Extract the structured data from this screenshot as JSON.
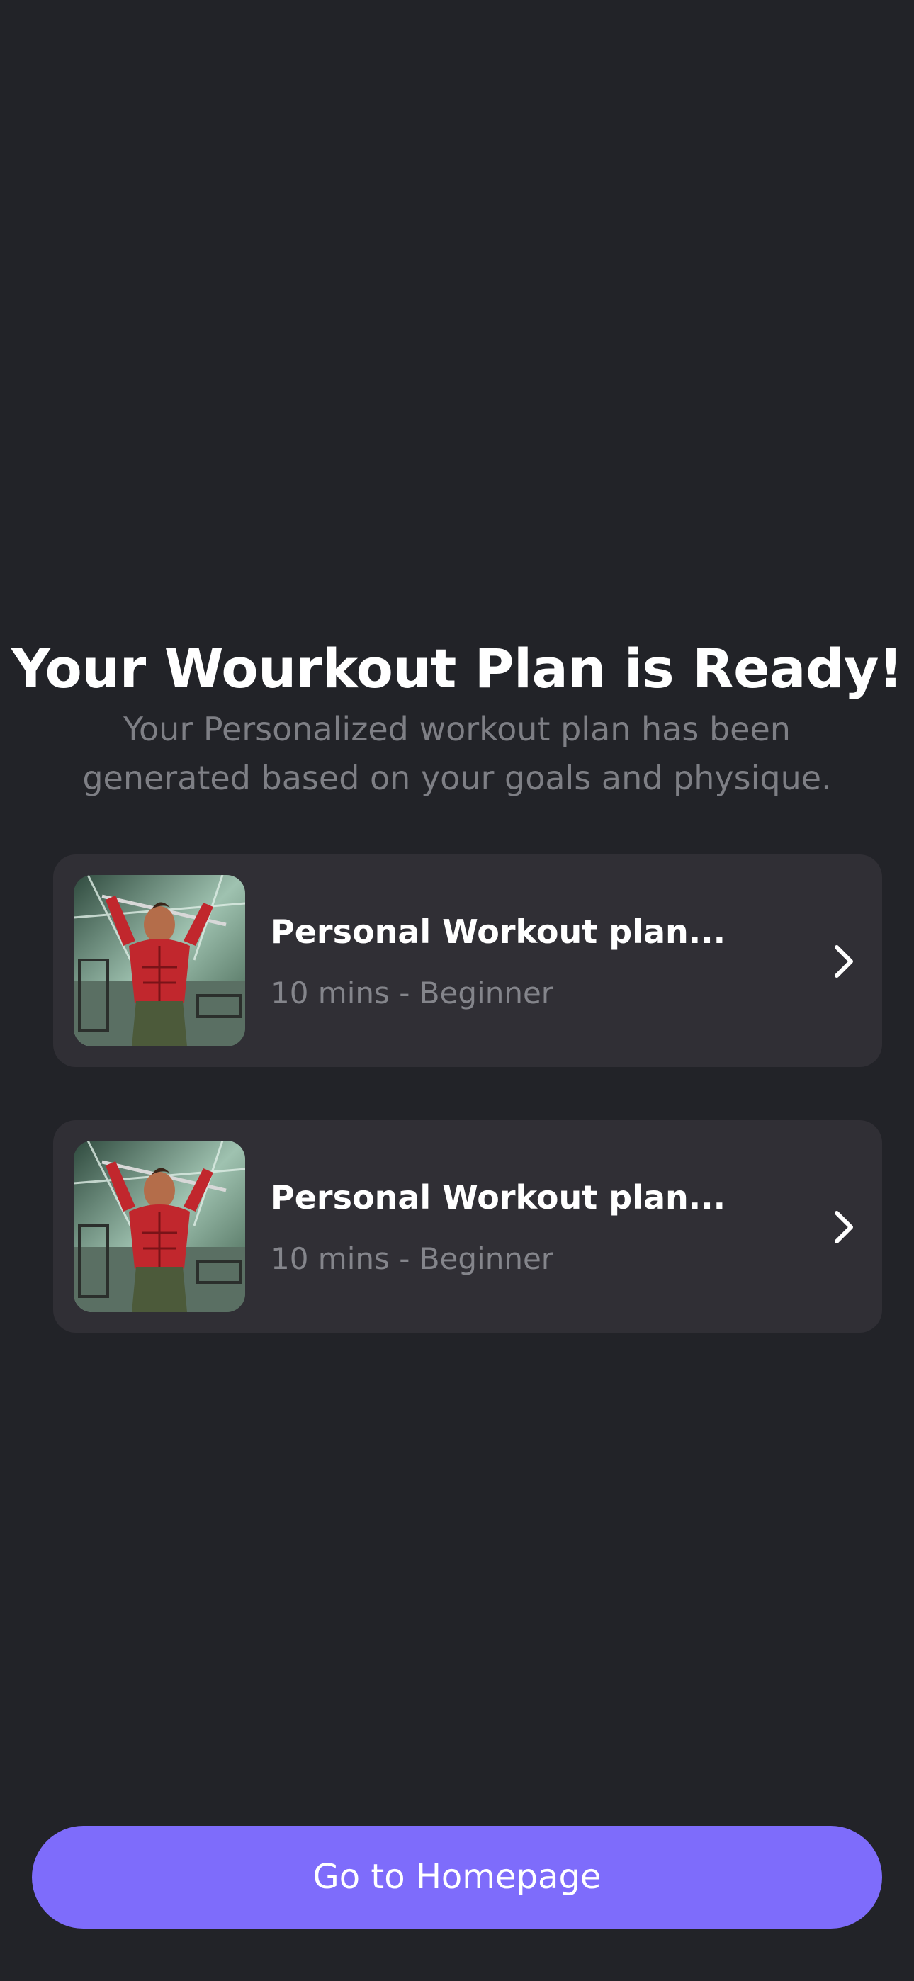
{
  "header": {
    "title": "Your Wourkout Plan is Ready!",
    "subtitle": "Your Personalized workout plan has been generated based on your goals and physique."
  },
  "plans": [
    {
      "title": "Personal Workout plan...",
      "meta": "10 mins - Beginner",
      "icon": "chevron-right-icon"
    },
    {
      "title": "Personal Workout plan...",
      "meta": "10 mins - Beginner",
      "icon": "chevron-right-icon"
    }
  ],
  "footer": {
    "cta_label": "Go to Homepage"
  },
  "colors": {
    "background": "#222328",
    "card": "#302f35",
    "accent": "#7e6cfb",
    "muted_text": "#7e7f85"
  }
}
